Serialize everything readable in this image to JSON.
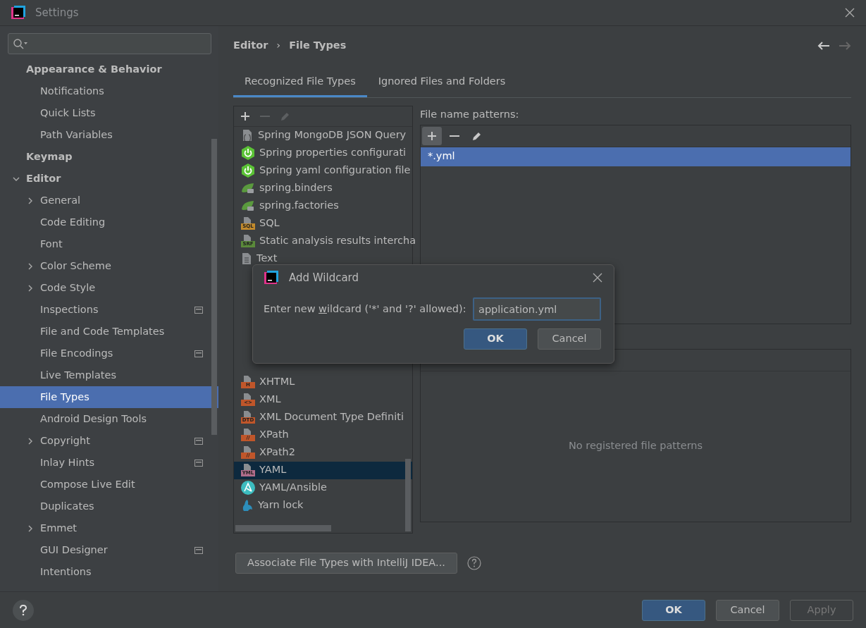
{
  "window": {
    "title": "Settings"
  },
  "sidebar": {
    "items": [
      {
        "label": "Appearance & Behavior",
        "bold": true,
        "children": [
          {
            "label": "Notifications"
          },
          {
            "label": "Quick Lists"
          },
          {
            "label": "Path Variables"
          }
        ]
      },
      {
        "label": "Keymap",
        "bold": true
      },
      {
        "label": "Editor",
        "bold": true,
        "expanded": true,
        "children": [
          {
            "label": "General",
            "expanded": false
          },
          {
            "label": "Code Editing"
          },
          {
            "label": "Font"
          },
          {
            "label": "Color Scheme",
            "expanded": false
          },
          {
            "label": "Code Style",
            "expanded": false
          },
          {
            "label": "Inspections",
            "project_scope": true
          },
          {
            "label": "File and Code Templates"
          },
          {
            "label": "File Encodings",
            "project_scope": true
          },
          {
            "label": "Live Templates"
          },
          {
            "label": "File Types",
            "selected": true
          },
          {
            "label": "Android Design Tools"
          },
          {
            "label": "Copyright",
            "expanded": false,
            "project_scope": true
          },
          {
            "label": "Inlay Hints",
            "project_scope": true
          },
          {
            "label": "Compose Live Edit"
          },
          {
            "label": "Duplicates"
          },
          {
            "label": "Emmet",
            "expanded": false
          },
          {
            "label": "GUI Designer",
            "project_scope": true
          },
          {
            "label": "Intentions"
          }
        ]
      }
    ]
  },
  "breadcrumb": [
    "Editor",
    "›",
    "File Types"
  ],
  "tabs": [
    {
      "label": "Recognized File Types",
      "selected": true
    },
    {
      "label": "Ignored Files and Folders",
      "selected": false
    }
  ],
  "file_types_top": [
    {
      "label": "Spring MongoDB JSON Query",
      "kind": "json",
      "selected": false
    },
    {
      "label": "Spring properties configurati",
      "kind": "spring",
      "selected": false
    },
    {
      "label": "Spring yaml configuration file",
      "kind": "spring",
      "selected": false
    },
    {
      "label": "spring.binders",
      "kind": "leaf",
      "selected": false
    },
    {
      "label": "spring.factories",
      "kind": "leaf",
      "selected": false
    },
    {
      "label": "SQL",
      "kind": "badge",
      "badge": "SQL",
      "color": "#c28a2c",
      "selected": false
    },
    {
      "label": "Static analysis results intercha",
      "kind": "badge",
      "badge": "SRF",
      "color": "#5a8a3a",
      "selected": false
    },
    {
      "label": "Text",
      "kind": "doc",
      "selected": false
    }
  ],
  "file_types_bottom": [
    {
      "label": "XHTML",
      "kind": "badge",
      "badge": "H",
      "color": "#c0562a",
      "selected": false
    },
    {
      "label": "XML",
      "kind": "badge",
      "badge": "<>",
      "color": "#c0562a",
      "selected": false
    },
    {
      "label": "XML Document Type Definiti",
      "kind": "badge",
      "badge": "DTD",
      "color": "#c0562a",
      "selected": false
    },
    {
      "label": "XPath",
      "kind": "badge",
      "badge": "//",
      "color": "#c0562a",
      "selected": false
    },
    {
      "label": "XPath2",
      "kind": "badge",
      "badge": "//",
      "color": "#c0562a",
      "selected": false
    },
    {
      "label": "YAML",
      "kind": "badge",
      "badge": "YML",
      "color": "#b06c8a",
      "selected": true
    },
    {
      "label": "YAML/Ansible",
      "kind": "ansible",
      "selected": false
    },
    {
      "label": "Yarn lock",
      "kind": "yarn",
      "selected": false
    }
  ],
  "patterns": {
    "label": "File name patterns:",
    "items": [
      {
        "label": "*.yml",
        "selected": true
      }
    ]
  },
  "hashbang": {
    "empty_text": "No registered file patterns"
  },
  "associate_button": "Associate File Types with IntelliJ IDEA...",
  "dialog": {
    "title": "Add Wildcard",
    "prompt_before": "Enter new ",
    "prompt_mnemonic": "w",
    "prompt_after": "ildcard ('*' and '?' allowed):",
    "value": "application.yml",
    "ok": "OK",
    "cancel": "Cancel"
  },
  "buttons": [
    {
      "label": "OK",
      "kind": "primary",
      "disabled": false
    },
    {
      "label": "Cancel",
      "kind": "normal",
      "disabled": false
    },
    {
      "label": "Apply",
      "kind": "normal",
      "disabled": true
    }
  ]
}
